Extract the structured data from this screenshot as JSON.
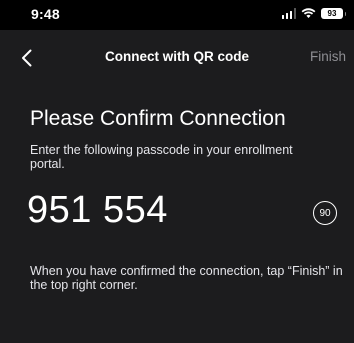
{
  "status_bar": {
    "time": "9:48",
    "battery_level": "93",
    "signal_icon": "signal-icon",
    "wifi_icon": "wifi-icon",
    "battery_icon": "battery-icon"
  },
  "nav": {
    "back_icon": "chevron-left-icon",
    "title": "Connect with QR code",
    "finish_label": "Finish"
  },
  "main": {
    "heading": "Please Confirm Connection",
    "instruction": "Enter the following passcode in your enrollment portal.",
    "passcode": "951 554",
    "countdown": "90",
    "confirm_note": "When you have confirmed the connection, tap “Finish” in the top right corner."
  },
  "colors": {
    "status_bar_background": "#000000",
    "screen_background": "#1c1c1e",
    "text": "#ffffff",
    "finish_disabled": "#8e8e93"
  }
}
